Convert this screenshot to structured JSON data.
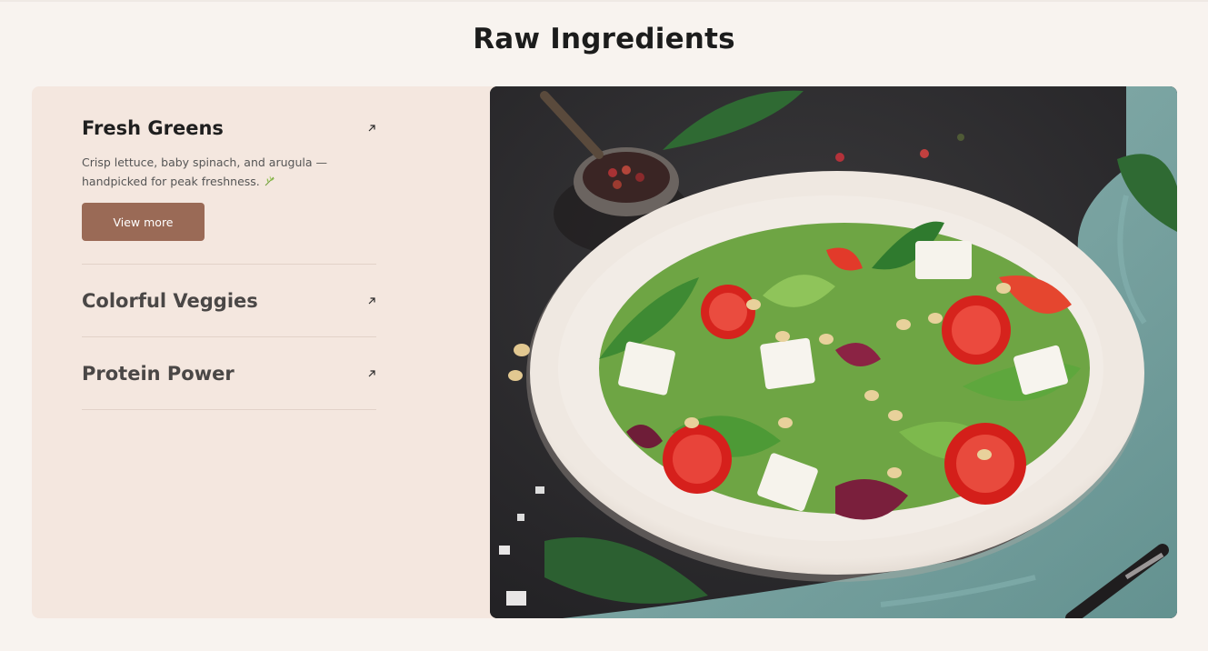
{
  "section": {
    "title": "Raw Ingredients"
  },
  "accordion": {
    "items": [
      {
        "title": "Fresh Greens",
        "state": "open",
        "description": "Crisp lettuce, baby spinach, and arugula — handpicked for peak freshness.",
        "button_label": "View more",
        "icon": "arrow-up-right-icon"
      },
      {
        "title": "Colorful Veggies",
        "state": "collapsed",
        "icon": "arrow-up-right-icon"
      },
      {
        "title": "Protein Power",
        "state": "collapsed",
        "icon": "arrow-up-right-icon"
      }
    ]
  },
  "image": {
    "subject": "salad-bowl-photo"
  },
  "colors": {
    "page_bg": "#f8f3ef",
    "panel_bg": "#f4e7df",
    "button_bg": "#9a6a56",
    "divider": "#e2d2c8"
  }
}
